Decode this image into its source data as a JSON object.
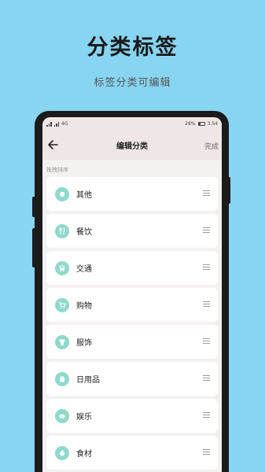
{
  "hero": {
    "title": "分类标签",
    "subtitle": "标签分类可编辑"
  },
  "status_bar": {
    "left_text": "4G",
    "battery": "28%",
    "time": "3:54"
  },
  "nav": {
    "title": "编辑分类",
    "done_label": "完成"
  },
  "hint": "拖拽排序",
  "categories": [
    {
      "label": "其他",
      "icon": "dot-icon"
    },
    {
      "label": "餐饮",
      "icon": "utensils-icon"
    },
    {
      "label": "交通",
      "icon": "bus-icon"
    },
    {
      "label": "购物",
      "icon": "cart-icon"
    },
    {
      "label": "服饰",
      "icon": "shirt-icon"
    },
    {
      "label": "日用品",
      "icon": "box-icon"
    },
    {
      "label": "娱乐",
      "icon": "gamepad-icon"
    },
    {
      "label": "食材",
      "icon": "food-icon"
    }
  ],
  "colors": {
    "background": "#87d5f1",
    "icon_accent": "#8fd9cc"
  }
}
